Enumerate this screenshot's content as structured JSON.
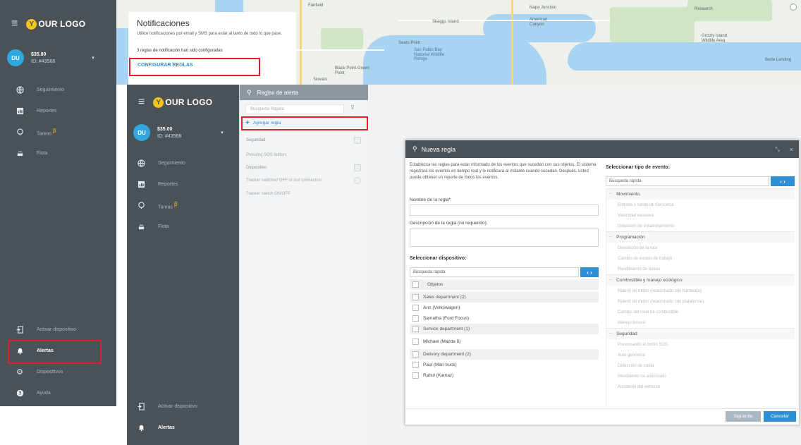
{
  "brand": {
    "logo_text": "OUR LOGO",
    "logo_letter": "Y"
  },
  "user": {
    "initials": "DU",
    "balance": "$35.00",
    "id": "ID: #43568"
  },
  "user2": {
    "initials": "DU",
    "balance": "$35.00",
    "id": "ID: #43568"
  },
  "nav": [
    {
      "label": "Seguimiento",
      "icon": "globe-icon"
    },
    {
      "label": "Reportes",
      "icon": "reports-icon"
    },
    {
      "label": "Tareas",
      "icon": "tasks-icon",
      "badge": "β"
    },
    {
      "label": "Flota",
      "icon": "car-icon"
    }
  ],
  "nav_bottom": [
    {
      "label": "Activar dispositivo",
      "icon": "activate-device-icon"
    },
    {
      "label": "Alertas",
      "icon": "bell-icon"
    },
    {
      "label": "Dispositivos",
      "icon": "gear-icon"
    },
    {
      "label": "Ayuda",
      "icon": "help-icon"
    }
  ],
  "nav2_bottom": [
    {
      "label": "Activar dispositivo",
      "icon": "activate-device-icon"
    },
    {
      "label": "Alertas",
      "icon": "bell-icon"
    }
  ],
  "map": {
    "labels": [
      "Fairfield",
      "Skaggs Island",
      "Napa Junction",
      "American Canyon",
      "Sears Point",
      "Grizzly Island Wildlife Area",
      "Bede Landing",
      "San Pablo Bay National Wildlife Refuge",
      "Novato",
      "Black Point-Green Point",
      "Research"
    ]
  },
  "notifications": {
    "title": "Notificaciones",
    "body": "Utilice notificaciones por email y SMS para estar al tanto de todo lo que pase.",
    "count": "3 reglas de notificación han sido configuradas",
    "link": "CONFIGURAR REGLAS"
  },
  "rules": {
    "title": "Reglas de alerta",
    "search_placeholder": "Búsqueda Rápida",
    "add_label": "Agregar regla",
    "sections": [
      {
        "name": "Seguridad",
        "items": [
          "Pressing SOS button"
        ]
      },
      {
        "name": "Dispositivo",
        "items": [
          "Tracker switched OFF or lost connection",
          "Tracker switch ON/OFF"
        ]
      }
    ]
  },
  "modal": {
    "title": "Nueva regla",
    "intro": "Establezca las reglas para estar informado de los eventos que suceden con sus objetos. El sistema registrará los eventos en tiempo real y le notificará al instante cuando sucedan. Después, usted puede obtener un reporte de todos los eventos.",
    "name_label": "Nombre de la regla*:",
    "desc_label": "Descripción de la regla (no requerido):",
    "device_heading": "Seleccionar dispositivo:",
    "device_search": "Búsqueda rápida",
    "devices_header": "Objetos",
    "devices": [
      {
        "type": "group",
        "label": "Sales department (2)"
      },
      {
        "type": "item",
        "label": "Ann (Volkswagen)"
      },
      {
        "type": "item",
        "label": "Samatha (Ford Focus)"
      },
      {
        "type": "group",
        "label": "Service department (1)"
      },
      {
        "type": "item",
        "label": "Michael (Mazda 6)"
      },
      {
        "type": "group",
        "label": "Delivery department (2)"
      },
      {
        "type": "item",
        "label": "Paul (Man truck)"
      },
      {
        "type": "item",
        "label": "Rahul (Kamaz)"
      }
    ],
    "event_heading": "Seleccionar tipo de evento:",
    "event_search": "Búsqueda rápida",
    "event_categories": [
      {
        "name": "Movimiento",
        "items": [
          "Entrada o salida de Geocerca",
          "Velocidad excesiva",
          "Detección de estacionamiento"
        ]
      },
      {
        "name": "Programación",
        "items": [
          "Desviación de la ruta",
          "Cambio de estado de trabajo",
          "Rendimiento de tareas"
        ]
      },
      {
        "name": "Combustible y manejo ecológico",
        "items": [
          "Ralentí de motor (relacionado con hardware)",
          "Ralentí de motor (relacionado con plataforma)",
          "Cambio del nivel de combustible",
          "Manejo brusco"
        ]
      },
      {
        "name": "Seguridad",
        "items": [
          "Presionando el botón SOS",
          "Auto geocerca",
          "Detección de caída",
          "Movimiento no autorizado",
          "Accidente del vehículo"
        ]
      }
    ],
    "next_label": "Siguiente",
    "cancel_label": "Cancelar"
  },
  "colors": {
    "sidebar": "#4a5258",
    "accent": "#2f8fd6",
    "highlight": "#d8232a",
    "logo": "#f5c518"
  }
}
